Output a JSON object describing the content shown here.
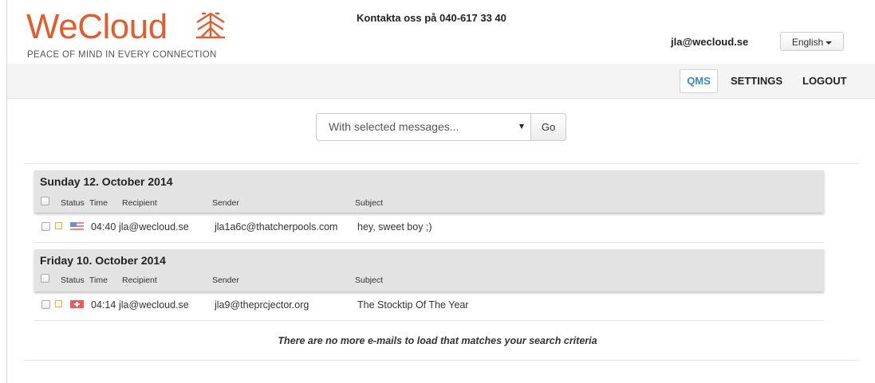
{
  "brand": {
    "logo_we": "We",
    "logo_cloud": "Cloud",
    "tagline": "PEACE OF MIND IN EVERY CONNECTION",
    "accent_color": "#e35c2d"
  },
  "header": {
    "contact": "Kontakta oss på 040-617 33 40",
    "user_email": "jla@wecloud.se",
    "language": "English"
  },
  "nav": {
    "items": [
      {
        "label": "QMS",
        "active": true
      },
      {
        "label": "SETTINGS"
      },
      {
        "label": "LOGOUT"
      }
    ]
  },
  "actions": {
    "select_value": "With selected messages...",
    "go_label": "Go"
  },
  "columns": {
    "status": "Status",
    "time": "Time",
    "recipient": "Recipient",
    "sender": "Sender",
    "subject": "Subject"
  },
  "groups": [
    {
      "date": "Sunday 12. October 2014",
      "messages": [
        {
          "flag": "us-flag-icon",
          "time": "04:40",
          "recipient": "jla@wecloud.se",
          "sender": "jla1a6c@thatcherpools.com",
          "subject": "hey, sweet boy ;)"
        }
      ]
    },
    {
      "date": "Friday 10. October 2014",
      "messages": [
        {
          "flag": "swiss-flag-icon",
          "time": "04:14",
          "recipient": "jla@wecloud.se",
          "sender": "jla9@theprcjector.org",
          "subject": "The Stocktip Of The Year"
        }
      ]
    }
  ],
  "footer_note": "There are no more e-mails to load that matches your search criteria"
}
